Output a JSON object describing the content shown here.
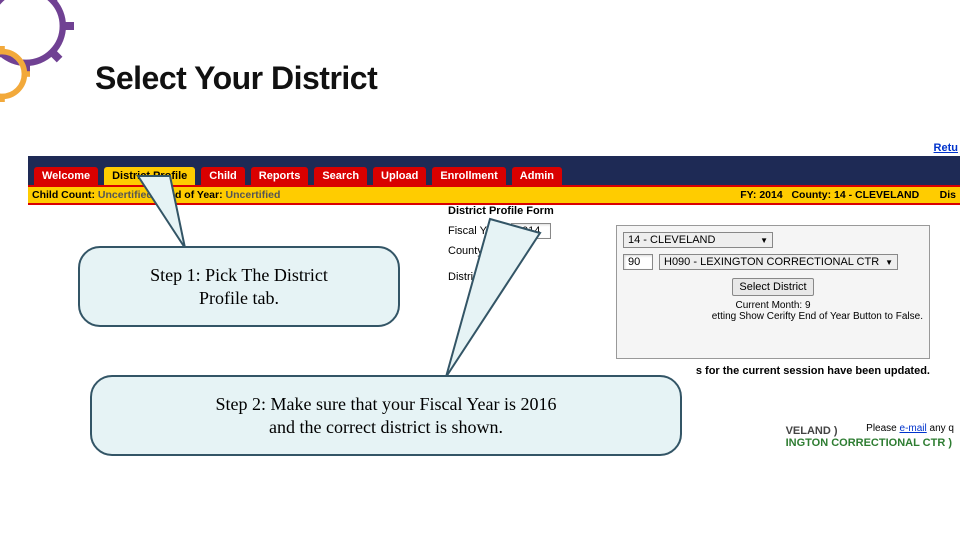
{
  "title": "Select Your District",
  "callouts": {
    "step1_line1": "Step 1:  Pick The District",
    "step1_line2": "Profile tab.",
    "step2_line1": "Step 2:  Make sure that your Fiscal Year is 2016",
    "step2_line2": "and the correct district is shown."
  },
  "top_link": "Retu",
  "tabs": {
    "welcome": "Welcome",
    "district_profile": "District Profile",
    "child": "Child",
    "reports": "Reports",
    "search": "Search",
    "upload": "Upload",
    "enrollment": "Enrollment",
    "admin": "Admin"
  },
  "status_bar": {
    "child_count_label": "Child Count:",
    "child_count_value": "Uncertified",
    "eoy_label": "| End of Year:",
    "eoy_value": "Uncertified",
    "fy_label": "FY:",
    "fy_value": "2014",
    "county_label": "County:",
    "county_value": "14 - CLEVELAND",
    "dist_label": "Dis"
  },
  "form": {
    "title": "District Profile Form",
    "fiscal_year_label": "Fiscal Year:",
    "fiscal_year_value": "2014",
    "county_label": "County:",
    "county_option": "14 - CLEVELAND",
    "district_label": "District:",
    "district_num": "90",
    "district_option": "H090 - LEXINGTON CORRECTIONAL CTR",
    "select_button": "Select District",
    "current_month": "Current Month: 9",
    "certify_line": "etting Show Cerifty End of Year Button to False.",
    "session_line": "s for the current session have been updated."
  },
  "side": {
    "line1": "VELAND )",
    "line2": "INGTON CORRECTIONAL CTR )"
  },
  "email": {
    "prefix": "Please ",
    "link": "e-mail",
    "suffix": " any q"
  }
}
